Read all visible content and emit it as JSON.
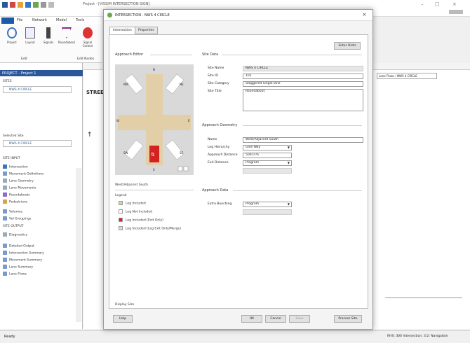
{
  "app": {
    "title": "Project - [VISSIM INTERSECTION SIGN]",
    "tabs": [
      "File",
      "Network",
      "Model",
      "Tools"
    ],
    "ribbon": [
      "Project",
      "Layout",
      "Signals",
      "Roundabout",
      "Signal Control"
    ],
    "ribbon_groups": [
      "Edit",
      "Edit Nodes"
    ]
  },
  "left_panel": {
    "header": "PROJECT - Project 1",
    "sites_label": "SITES",
    "site_value": "NWS 4 CIRCLE",
    "selected_site_label": "Selected Site",
    "selected_site_value": "NWS 4 CIRCLE",
    "site_input_label": "SITE INPUT",
    "input_items": [
      "Intersection",
      "Movement Definitions",
      "Lane Geometry",
      "Lane Movements",
      "Roundabouts",
      "Pedestrians",
      "Volumes",
      "Vol Groupings"
    ],
    "site_output_label": "SITE OUTPUT",
    "output_items": [
      "Diagnostics",
      "Detailed Output",
      "Intersection Summary",
      "Movement Summary",
      "Lane Summary",
      "Lane Flows"
    ]
  },
  "canvas": {
    "title": "STREET NAME",
    "tabs": [
      "Lane Flows",
      "NWS 4 CIRCLE"
    ]
  },
  "status": {
    "left": "Ready",
    "right": "RHS: 300 Intersection: 3:2: Navigation"
  },
  "dialog": {
    "title": "INTERSECTION - NWS 4 CIRCLE",
    "tabs": [
      "Intersection",
      "Properties"
    ],
    "top_button": "Enter Hints",
    "approach_editor_label": "Approach Editor",
    "directions": [
      "N",
      "NE",
      "E",
      "SE",
      "S",
      "SW",
      "W",
      "NW"
    ],
    "selected_approach": "West/Adjacent South",
    "legend_title": "Legend",
    "legend": [
      {
        "label": "Leg Included",
        "color": "#e3cfa7"
      },
      {
        "label": "Leg Not Included",
        "color": "#ffffff"
      },
      {
        "label": "Leg Included (Exit Only)",
        "color": "#d32222"
      },
      {
        "label": "Leg Included (Leg Exit Only/Merge)",
        "color": "#f2d2d2"
      }
    ],
    "site_data_label": "Site Data",
    "site_fields": [
      {
        "label": "Site Name",
        "value": "NWS 4 CIRCLE"
      },
      {
        "label": "Site ID",
        "value": "101"
      },
      {
        "label": "Site Category",
        "value": "Staggered Single lane"
      },
      {
        "label": "Site Title",
        "value": "Roundabout"
      }
    ],
    "approach_geometry_label": "Approach Geometry",
    "geometry_fields": [
      {
        "label": "Name",
        "value": "West/Adjacent South"
      },
      {
        "label": "Leg Hierarchy",
        "value": "Give Way"
      },
      {
        "label": "Approach Distance",
        "value": "500.0 m"
      },
      {
        "label": "Exit Distance",
        "value": "Program"
      }
    ],
    "approach_data_label": "Approach Data",
    "data_fields": [
      {
        "label": "Extra Bunching",
        "value": "Program"
      }
    ],
    "display_size_label": "Display Size",
    "buttons": {
      "help": "Help",
      "ok": "OK",
      "cancel": "Cancel",
      "save": "Save",
      "process": "Process Site"
    }
  },
  "colors": {
    "road": "#e3cfa7",
    "exit_arrow": "#d32222",
    "header_blue": "#2b579a",
    "diagram_bg": "#d9d9d9"
  }
}
